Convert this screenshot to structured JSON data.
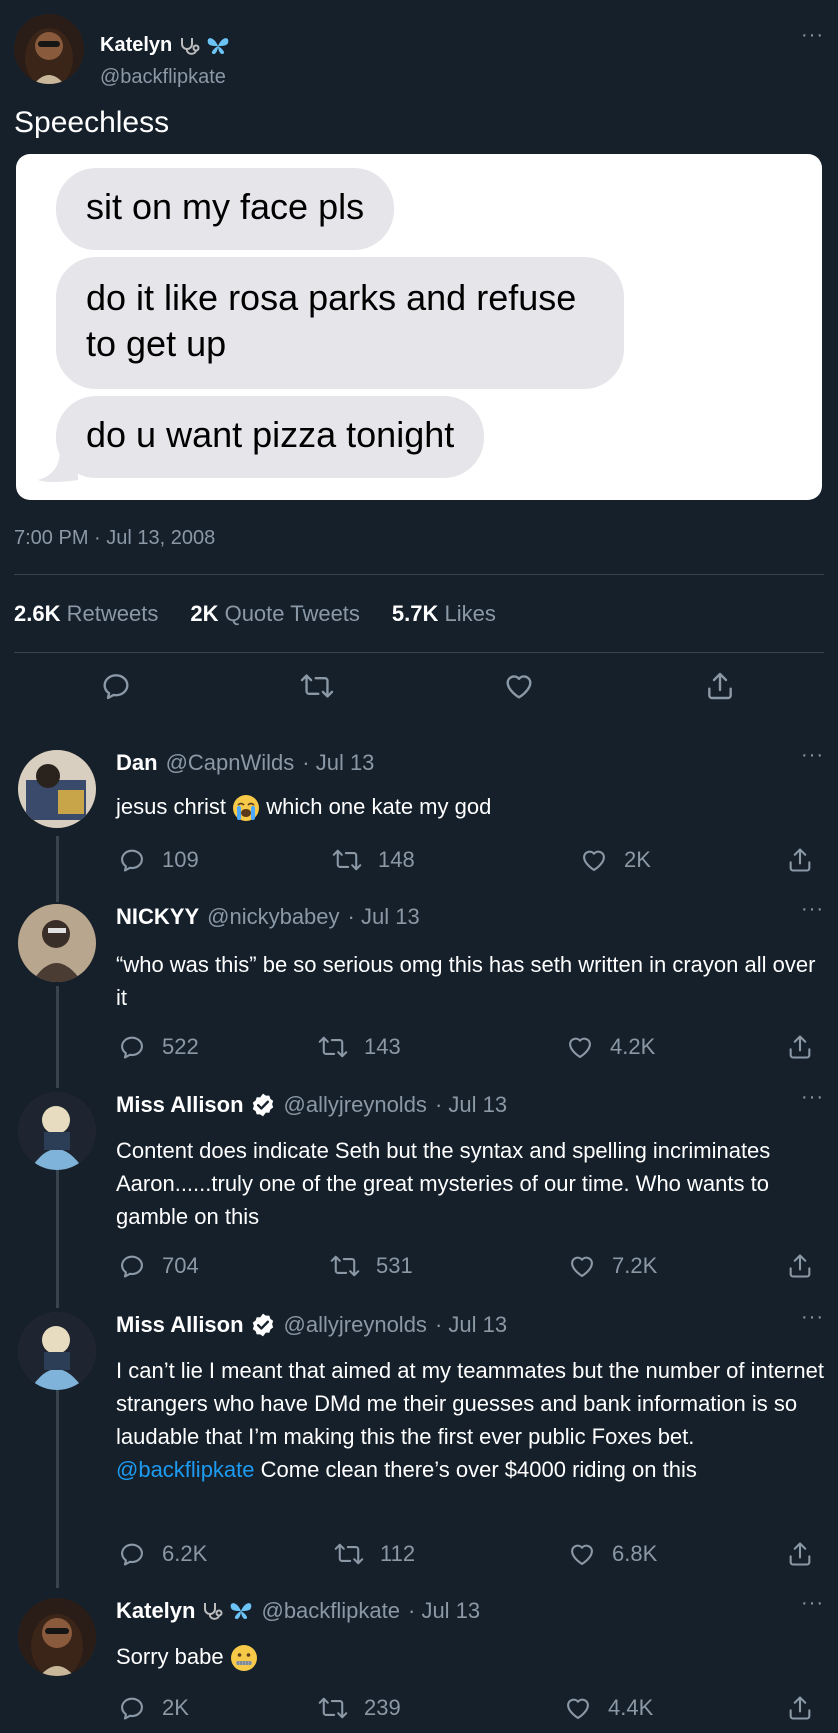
{
  "colors": {
    "background": "#15202b",
    "muted": "#8b98a5",
    "link": "#1d9bf0",
    "divider": "#38444d"
  },
  "main_tweet": {
    "author_name": "Katelyn",
    "author_handle": "@backflipkate",
    "text": "Speechless",
    "image_messages": [
      "sit on my face pls",
      "do it like rosa parks and refuse to get up",
      "do u want pizza tonight"
    ],
    "timestamp": "7:00 PM · Jul 13, 2008",
    "stats": {
      "retweets_count": "2.6K",
      "retweets_label": "Retweets",
      "quotes_count": "2K",
      "quotes_label": "Quote Tweets",
      "likes_count": "5.7K",
      "likes_label": "Likes"
    },
    "more_menu": "···"
  },
  "replies": [
    {
      "name": "Dan",
      "handle": "@CapnWilds",
      "date": "· Jul 13",
      "text_before": "jesus christ",
      "text_after": "which one kate my god",
      "replies": "109",
      "retweets": "148",
      "likes": "2K"
    },
    {
      "name": "NICKYY",
      "handle": "@nickybabey",
      "date": "· Jul 13",
      "text": "“who was this” be so serious omg this has seth written in crayon all over it",
      "replies": "522",
      "retweets": "143",
      "likes": "4.2K"
    },
    {
      "name": "Miss Allison",
      "handle": "@allyjreynolds",
      "date": "· Jul 13",
      "text": "Content does indicate Seth but the syntax and spelling incriminates Aaron......truly one of the great mysteries of our time. Who wants to gamble on this",
      "replies": "704",
      "retweets": "531",
      "likes": "7.2K"
    },
    {
      "name": "Miss Allison",
      "handle": "@allyjreynolds",
      "date": "· Jul 13",
      "text_before": "I can’t lie I meant that aimed at my teammates but the number of internet strangers who have DMd me their guesses and bank information is so laudable that I’m making this the first ever public Foxes bet.",
      "mention": "@backflipkate",
      "text_after": "Come clean there’s over $4000 riding on this",
      "replies": "6.2K",
      "retweets": "112",
      "likes": "6.8K"
    },
    {
      "name": "Katelyn",
      "handle": "@backflipkate",
      "date": "· Jul 13",
      "text": "Sorry babe",
      "replies": "2K",
      "retweets": "239",
      "likes": "4.4K"
    }
  ]
}
